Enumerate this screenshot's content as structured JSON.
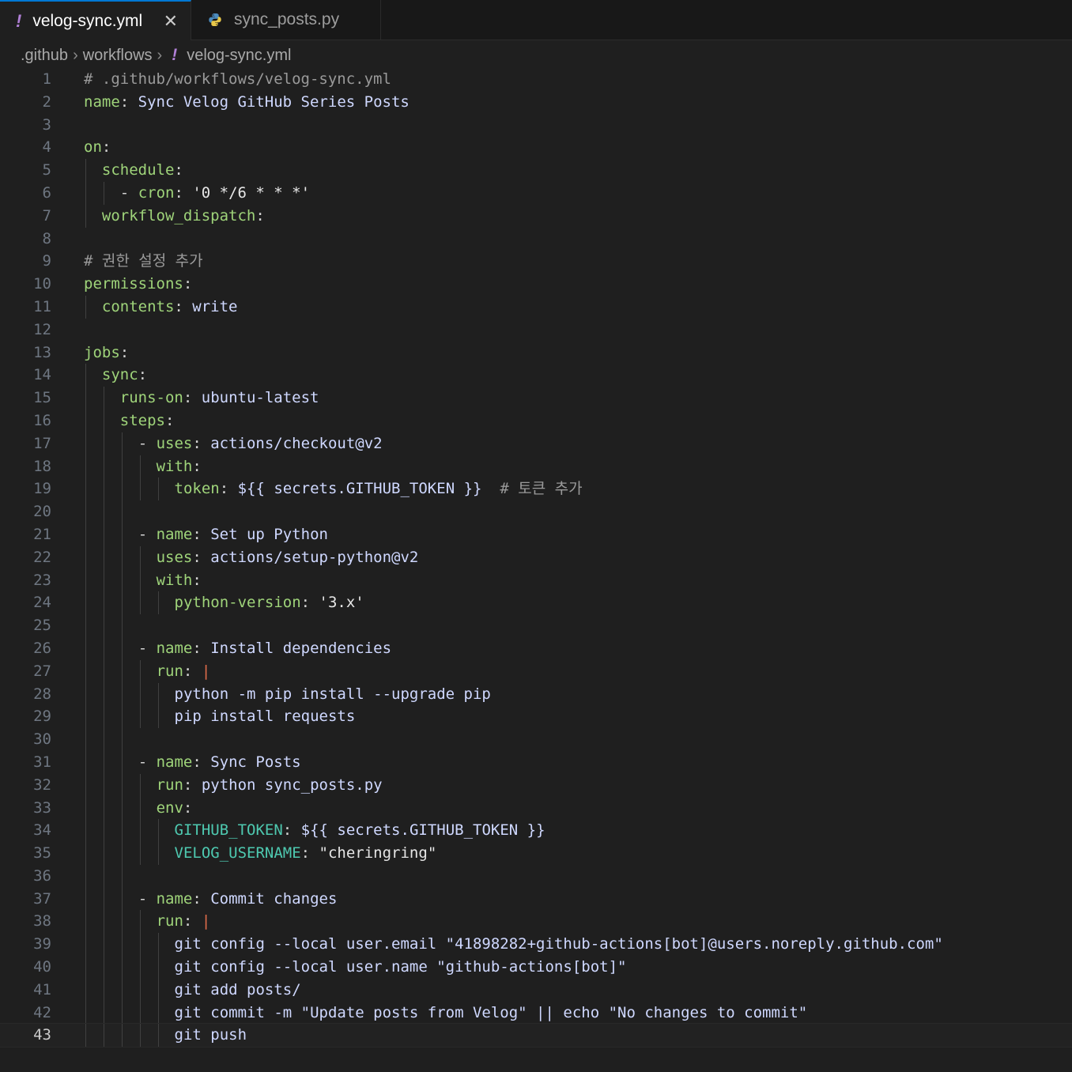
{
  "tabs": [
    {
      "label": "velog-sync.yml",
      "icon": "yml-icon",
      "active": true
    },
    {
      "label": "sync_posts.py",
      "icon": "python-icon",
      "active": false
    }
  ],
  "breadcrumb": {
    "parts": [
      ".github",
      "workflows",
      "velog-sync.yml"
    ]
  },
  "editor": {
    "current_line": 43,
    "lines": [
      {
        "n": "1",
        "indent": 0,
        "t": [
          [
            "c",
            "# .github/workflows/velog-sync.yml"
          ]
        ]
      },
      {
        "n": "2",
        "indent": 0,
        "t": [
          [
            "k",
            "name"
          ],
          [
            "p",
            ": "
          ],
          [
            "v",
            "Sync Velog GitHub Series Posts"
          ]
        ]
      },
      {
        "n": "3",
        "indent": 0,
        "t": []
      },
      {
        "n": "4",
        "indent": 0,
        "t": [
          [
            "k",
            "on"
          ],
          [
            "p",
            ":"
          ]
        ]
      },
      {
        "n": "5",
        "indent": 1,
        "t": [
          [
            "k",
            "schedule"
          ],
          [
            "p",
            ":"
          ]
        ]
      },
      {
        "n": "6",
        "indent": 2,
        "t": [
          [
            "p",
            "- "
          ],
          [
            "k",
            "cron"
          ],
          [
            "p",
            ": "
          ],
          [
            "s",
            "'0 */6 * * *'"
          ]
        ]
      },
      {
        "n": "7",
        "indent": 1,
        "t": [
          [
            "k",
            "workflow_dispatch"
          ],
          [
            "p",
            ":"
          ]
        ]
      },
      {
        "n": "8",
        "indent": 0,
        "t": []
      },
      {
        "n": "9",
        "indent": 0,
        "t": [
          [
            "c",
            "# 권한 설정 추가"
          ]
        ]
      },
      {
        "n": "10",
        "indent": 0,
        "t": [
          [
            "k",
            "permissions"
          ],
          [
            "p",
            ":"
          ]
        ]
      },
      {
        "n": "11",
        "indent": 1,
        "t": [
          [
            "k",
            "contents"
          ],
          [
            "p",
            ": "
          ],
          [
            "v",
            "write"
          ]
        ]
      },
      {
        "n": "12",
        "indent": 0,
        "t": []
      },
      {
        "n": "13",
        "indent": 0,
        "t": [
          [
            "k",
            "jobs"
          ],
          [
            "p",
            ":"
          ]
        ]
      },
      {
        "n": "14",
        "indent": 1,
        "t": [
          [
            "k",
            "sync"
          ],
          [
            "p",
            ":"
          ]
        ]
      },
      {
        "n": "15",
        "indent": 2,
        "t": [
          [
            "k",
            "runs-on"
          ],
          [
            "p",
            ": "
          ],
          [
            "v",
            "ubuntu-latest"
          ]
        ]
      },
      {
        "n": "16",
        "indent": 2,
        "t": [
          [
            "k",
            "steps"
          ],
          [
            "p",
            ":"
          ]
        ]
      },
      {
        "n": "17",
        "indent": 3,
        "t": [
          [
            "p",
            "- "
          ],
          [
            "k",
            "uses"
          ],
          [
            "p",
            ": "
          ],
          [
            "v",
            "actions/checkout@v2"
          ]
        ]
      },
      {
        "n": "18",
        "indent": 4,
        "t": [
          [
            "k",
            "with"
          ],
          [
            "p",
            ":"
          ]
        ]
      },
      {
        "n": "19",
        "indent": 5,
        "t": [
          [
            "k",
            "token"
          ],
          [
            "p",
            ": "
          ],
          [
            "v",
            "${{ secrets.GITHUB_TOKEN }}"
          ],
          [
            "p",
            "  "
          ],
          [
            "c",
            "# 토큰 추가"
          ]
        ]
      },
      {
        "n": "20",
        "indent": 3,
        "t": []
      },
      {
        "n": "21",
        "indent": 3,
        "t": [
          [
            "p",
            "- "
          ],
          [
            "k",
            "name"
          ],
          [
            "p",
            ": "
          ],
          [
            "v",
            "Set up Python"
          ]
        ]
      },
      {
        "n": "22",
        "indent": 4,
        "t": [
          [
            "k",
            "uses"
          ],
          [
            "p",
            ": "
          ],
          [
            "v",
            "actions/setup-python@v2"
          ]
        ]
      },
      {
        "n": "23",
        "indent": 4,
        "t": [
          [
            "k",
            "with"
          ],
          [
            "p",
            ":"
          ]
        ]
      },
      {
        "n": "24",
        "indent": 5,
        "t": [
          [
            "k",
            "python-version"
          ],
          [
            "p",
            ": "
          ],
          [
            "s",
            "'3.x'"
          ]
        ]
      },
      {
        "n": "25",
        "indent": 3,
        "t": []
      },
      {
        "n": "26",
        "indent": 3,
        "t": [
          [
            "p",
            "- "
          ],
          [
            "k",
            "name"
          ],
          [
            "p",
            ": "
          ],
          [
            "v",
            "Install dependencies"
          ]
        ]
      },
      {
        "n": "27",
        "indent": 4,
        "t": [
          [
            "k",
            "run"
          ],
          [
            "p",
            ": "
          ],
          [
            "bar",
            "|"
          ]
        ]
      },
      {
        "n": "28",
        "indent": 5,
        "t": [
          [
            "v",
            "python -m pip install --upgrade pip"
          ]
        ]
      },
      {
        "n": "29",
        "indent": 5,
        "t": [
          [
            "v",
            "pip install requests"
          ]
        ]
      },
      {
        "n": "30",
        "indent": 3,
        "t": []
      },
      {
        "n": "31",
        "indent": 3,
        "t": [
          [
            "p",
            "- "
          ],
          [
            "k",
            "name"
          ],
          [
            "p",
            ": "
          ],
          [
            "v",
            "Sync Posts"
          ]
        ]
      },
      {
        "n": "32",
        "indent": 4,
        "t": [
          [
            "k",
            "run"
          ],
          [
            "p",
            ": "
          ],
          [
            "v",
            "python sync_posts.py"
          ]
        ]
      },
      {
        "n": "33",
        "indent": 4,
        "t": [
          [
            "k",
            "env"
          ],
          [
            "p",
            ":"
          ]
        ]
      },
      {
        "n": "34",
        "indent": 5,
        "t": [
          [
            "kd",
            "GITHUB_TOKEN"
          ],
          [
            "p",
            ": "
          ],
          [
            "v",
            "${{ secrets.GITHUB_TOKEN }}"
          ]
        ]
      },
      {
        "n": "35",
        "indent": 5,
        "t": [
          [
            "kd",
            "VELOG_USERNAME"
          ],
          [
            "p",
            ": "
          ],
          [
            "s",
            "\"cheringring\""
          ]
        ]
      },
      {
        "n": "36",
        "indent": 3,
        "t": []
      },
      {
        "n": "37",
        "indent": 3,
        "t": [
          [
            "p",
            "- "
          ],
          [
            "k",
            "name"
          ],
          [
            "p",
            ": "
          ],
          [
            "v",
            "Commit changes"
          ]
        ]
      },
      {
        "n": "38",
        "indent": 4,
        "t": [
          [
            "k",
            "run"
          ],
          [
            "p",
            ": "
          ],
          [
            "bar",
            "|"
          ]
        ]
      },
      {
        "n": "39",
        "indent": 5,
        "t": [
          [
            "v",
            "git config --local user.email \"41898282+github-actions[bot]@users.noreply.github.com\""
          ]
        ]
      },
      {
        "n": "40",
        "indent": 5,
        "t": [
          [
            "v",
            "git config --local user.name \"github-actions[bot]\""
          ]
        ]
      },
      {
        "n": "41",
        "indent": 5,
        "t": [
          [
            "v",
            "git add posts/"
          ]
        ]
      },
      {
        "n": "42",
        "indent": 5,
        "t": [
          [
            "v",
            "git commit -m \"Update posts from Velog\" || echo \"No changes to commit\""
          ]
        ]
      },
      {
        "n": "43",
        "indent": 5,
        "t": [
          [
            "v",
            "git push"
          ]
        ]
      }
    ]
  }
}
